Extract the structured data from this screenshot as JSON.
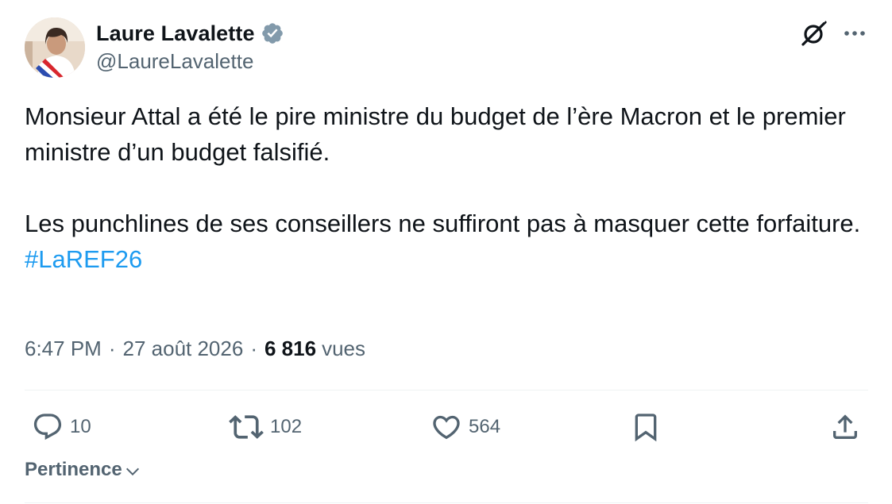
{
  "author": {
    "display_name": "Laure Lavalette",
    "handle": "@LaureLavalette",
    "verified": true,
    "avatar_icon": "profile-photo"
  },
  "tweet": {
    "paragraph1": "Monsieur Attal a été le pire ministre du budget de l’ère Macron et le premier ministre d’un budget falsifié.",
    "paragraph2": "Les punchlines de ses conseillers ne suffiront pas à masquer cette forfaiture.",
    "hashtag": "#LaREF26"
  },
  "meta": {
    "time": "6:47 PM",
    "separator": "·",
    "date": "27 août 2026",
    "views_count": "6 816",
    "views_label": "vues"
  },
  "actions": {
    "replies": "10",
    "retweets": "102",
    "likes": "564"
  },
  "sort": {
    "label": "Pertinence"
  },
  "colors": {
    "text": "#0f1419",
    "secondary": "#536471",
    "link": "#1d9bf0",
    "divider": "#eff3f4",
    "verified_badge": "#829aab"
  },
  "icons": {
    "grok": "grok-icon",
    "more": "more-icon",
    "reply": "reply-icon",
    "retweet": "retweet-icon",
    "like": "heart-icon",
    "bookmark": "bookmark-icon",
    "share": "share-icon",
    "chevron": "chevron-down-icon",
    "verified": "verified-badge-icon"
  }
}
